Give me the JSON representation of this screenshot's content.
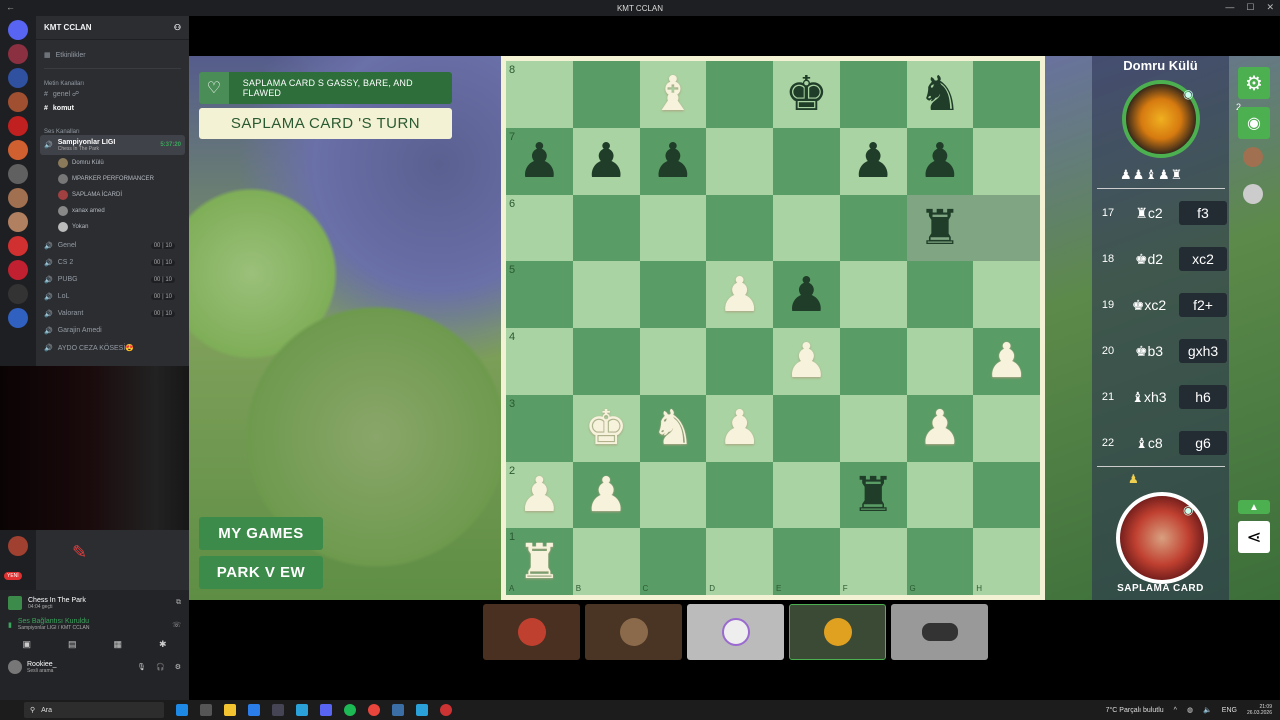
{
  "window": {
    "title": "KMT CCLAN"
  },
  "discord": {
    "guild_name": "KMT CCLAN",
    "events_label": "Etkinlikler",
    "text_category": "Metin Kanalları",
    "text_channels": [
      "genel ☍",
      "komut"
    ],
    "voice_category": "Ses Kanalları",
    "active_voice": {
      "name": "Sampiyonlar LIGI",
      "timer": "5:37:20",
      "activity": "Chess In The Park"
    },
    "voice_users": [
      "Domru Külü",
      "MPARKER PERFORMANCER",
      "SAPLAMA İCARDİ",
      "xanax amed",
      "Yokan"
    ],
    "voice_channels": [
      {
        "name": "Genel",
        "a": "00",
        "b": "10"
      },
      {
        "name": "CS 2",
        "a": "00",
        "b": "10"
      },
      {
        "name": "PUBG",
        "a": "00",
        "b": "10"
      },
      {
        "name": "LoL",
        "a": "00",
        "b": "10"
      },
      {
        "name": "Valorant",
        "a": "00",
        "b": "10"
      },
      {
        "name": "Garajin Amedi",
        "a": "",
        "b": ""
      },
      {
        "name": "AYDO CEZA KÖSESİ😍",
        "a": "",
        "b": ""
      }
    ],
    "activity_title": "Chess In The Park",
    "activity_time": "04:04 geçti",
    "voice_status": "Ses Bağlantısı Kuruldu",
    "voice_location": "Sampiyonlar LIGI / KMT CCLAN",
    "user_name": "Rookiee_",
    "user_status": "Sesli arama",
    "new_badge": "YENİ"
  },
  "game": {
    "banner": "SAPLAMA  CARD   S GASSY, BARE, AND FLAWED",
    "turn": "SAPLAMA  CARD 'S TURN",
    "my_games": "MY GAMES",
    "park_view": "PARK V EW",
    "opponent": "Domru Külü",
    "captured_by_opp": "♟♟♝♟♜",
    "captured_by_me": "♟",
    "me": "SAPLAMA  CARD",
    "participants_count": "2",
    "moves": [
      {
        "n": "17",
        "w": "♜c2",
        "b": "f3"
      },
      {
        "n": "18",
        "w": "♚d2",
        "b": "xc2"
      },
      {
        "n": "19",
        "w": "♚xc2",
        "b": "f2+"
      },
      {
        "n": "20",
        "w": "♚b3",
        "b": "gxh3"
      },
      {
        "n": "21",
        "w": "♝xh3",
        "b": "h6"
      },
      {
        "n": "22",
        "w": "♝c8",
        "b": "g6"
      }
    ],
    "ranks": [
      "8",
      "7",
      "6",
      "5",
      "4",
      "3",
      "2",
      "1"
    ],
    "files": [
      "A",
      "B",
      "C",
      "D",
      "E",
      "F",
      "G",
      "H"
    ],
    "board": [
      [
        "",
        "",
        "wB",
        "",
        "bK",
        "",
        "bN",
        ""
      ],
      [
        "bP",
        "bP",
        "bP",
        "",
        "",
        "bP",
        "bP",
        ""
      ],
      [
        "",
        "",
        "",
        "",
        "",
        "",
        "bR",
        ""
      ],
      [
        "",
        "",
        "",
        "wP",
        "bP",
        "",
        "",
        ""
      ],
      [
        "",
        "",
        "",
        "",
        "wP",
        "",
        "",
        "wP"
      ],
      [
        "",
        "wK",
        "wN",
        "wP",
        "",
        "",
        "wP",
        ""
      ],
      [
        "wP",
        "wP",
        "",
        "",
        "",
        "bR",
        "",
        ""
      ],
      [
        "wR",
        "",
        "",
        "",
        "",
        "",
        "",
        ""
      ]
    ]
  },
  "taskbar": {
    "search": "Ara",
    "weather": "7°C  Parçalı bulutlu",
    "lang": "ENG",
    "time": "21:09",
    "date": "26.03.2026"
  }
}
